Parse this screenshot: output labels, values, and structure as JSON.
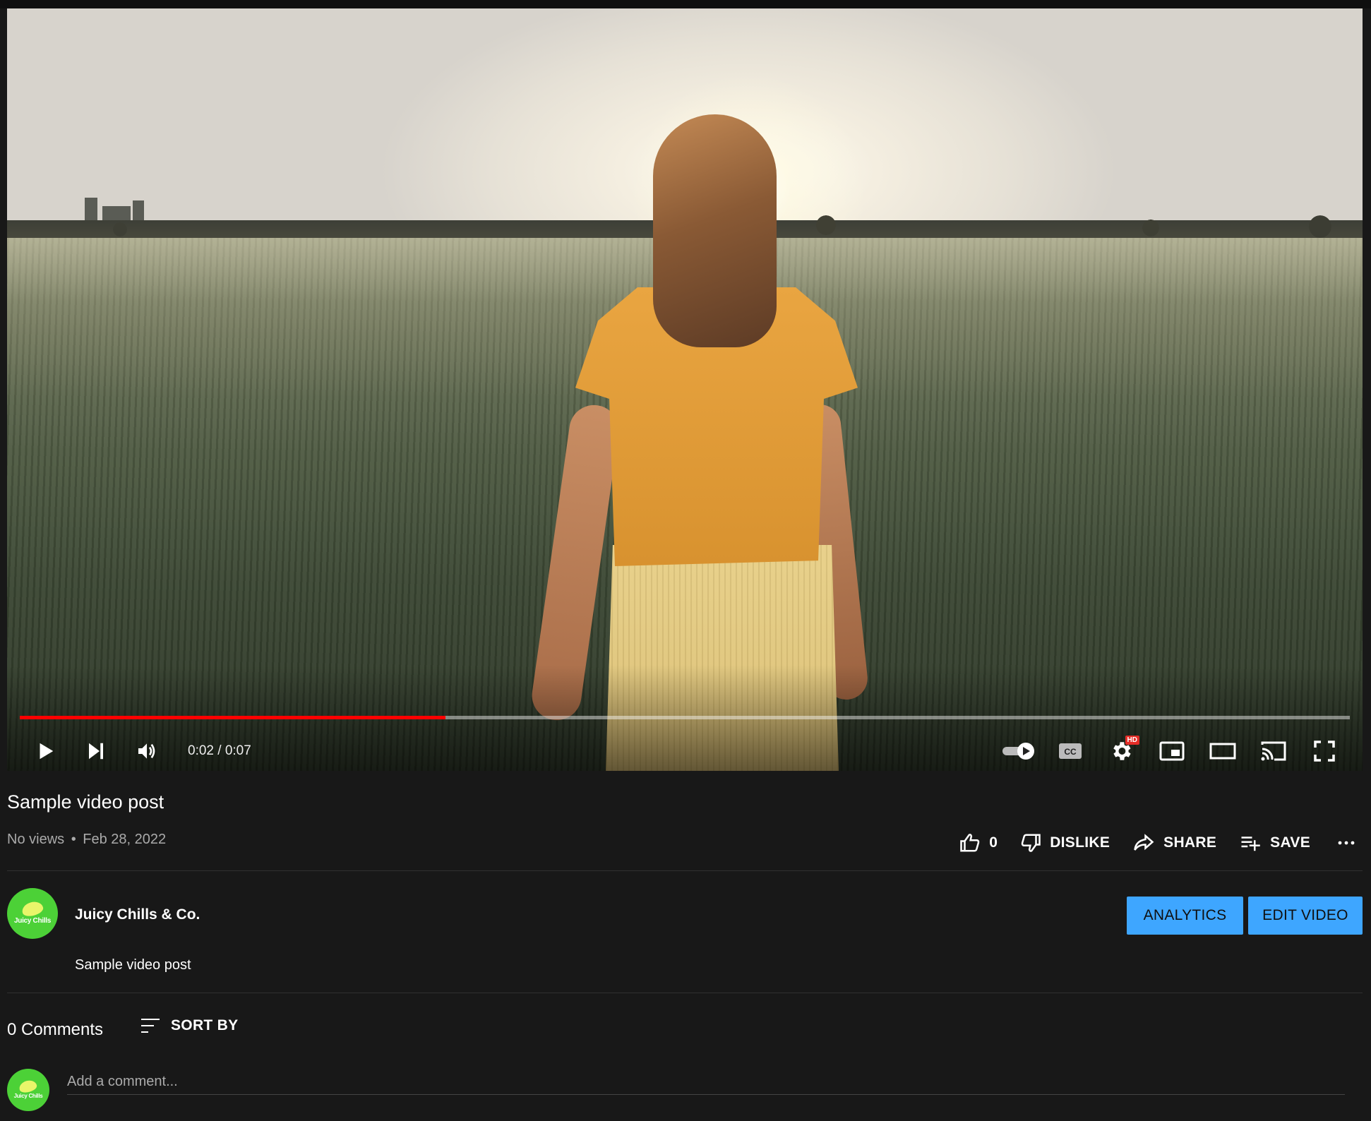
{
  "video": {
    "progress_fraction": 0.32,
    "time_display": "0:02 / 0:07",
    "hd_badge": "HD",
    "cc_label": "CC",
    "progress_color": "#ff0000"
  },
  "info": {
    "title": "Sample video post",
    "views": "No views",
    "separator": "•",
    "date": "Feb 28, 2022"
  },
  "actions": {
    "like_count": "0",
    "dislike_label": "DISLIKE",
    "share_label": "SHARE",
    "save_label": "SAVE"
  },
  "channel": {
    "name": "Juicy Chills & Co.",
    "avatar_text": "Juicy Chills",
    "avatar_color": "#4cd137",
    "description": "Sample video post"
  },
  "buttons": {
    "analytics": "ANALYTICS",
    "edit_video": "EDIT VIDEO",
    "accent": "#3ea6ff"
  },
  "comments": {
    "count_label": "0 Comments",
    "sort_label": "SORT BY",
    "placeholder": "Add a comment..."
  },
  "icons": [
    "play-icon",
    "next-icon",
    "volume-icon",
    "autoplay-toggle-icon",
    "captions-icon",
    "settings-icon",
    "miniplayer-icon",
    "theater-icon",
    "cast-icon",
    "fullscreen-icon",
    "like-icon",
    "dislike-icon",
    "share-icon",
    "save-playlist-icon",
    "more-icon",
    "sort-icon"
  ]
}
